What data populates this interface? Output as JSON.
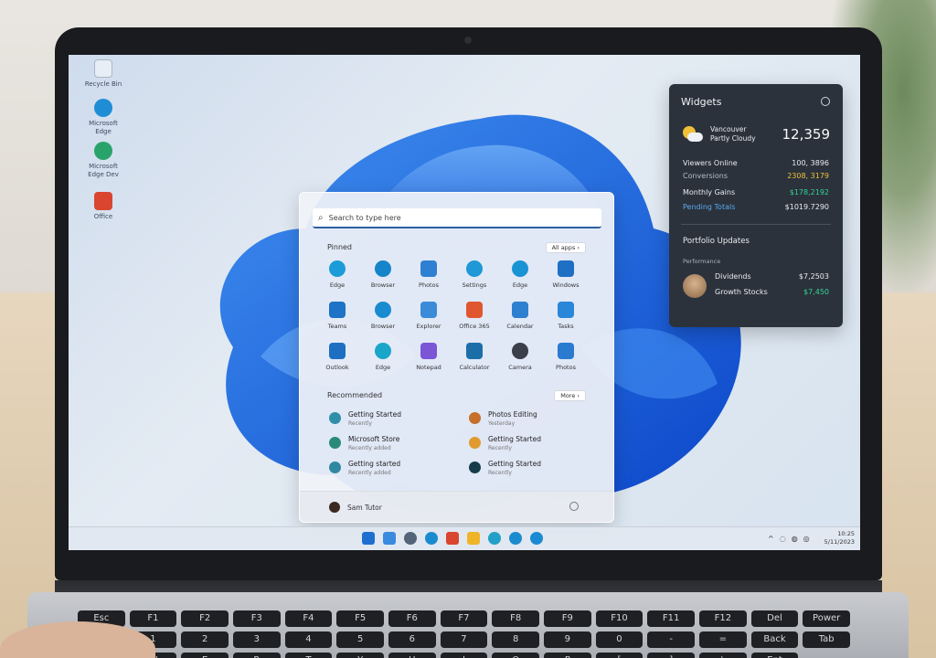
{
  "desktop": {
    "icons": [
      {
        "label": "Recycle Bin",
        "icon": "recycle-bin-icon",
        "color": "#e8eef5"
      },
      {
        "label": "Microsoft Edge",
        "icon": "edge-icon",
        "color": "#1f8dd6"
      },
      {
        "label": "Microsoft Edge Dev",
        "icon": "edge-icon",
        "color": "#2aa36b"
      },
      {
        "label": "Office",
        "icon": "office-icon",
        "color": "#d9452f"
      }
    ]
  },
  "start_menu": {
    "search_placeholder": "Search to type here",
    "pinned": {
      "title": "Pinned",
      "button": "All apps  ›"
    },
    "apps": [
      {
        "label": "Edge",
        "icon": "edge-icon",
        "color": "#1b9bd8"
      },
      {
        "label": "Browser",
        "icon": "edge-icon",
        "color": "#1584c8"
      },
      {
        "label": "Photos",
        "icon": "photos-icon",
        "color": "#2f7fd2"
      },
      {
        "label": "Settings",
        "icon": "edge-icon",
        "color": "#1e98d6"
      },
      {
        "label": "Edge",
        "icon": "edge-icon",
        "color": "#1893d4"
      },
      {
        "label": "Windows",
        "icon": "windows-icon",
        "color": "#1f6fc4"
      },
      {
        "label": "Teams",
        "icon": "teams-icon",
        "color": "#1e73c6"
      },
      {
        "label": "Browser",
        "icon": "edge-icon",
        "color": "#1a8bd0"
      },
      {
        "label": "Explorer",
        "icon": "folder-icon",
        "color": "#3b8bd8"
      },
      {
        "label": "Office 365",
        "icon": "office-icon",
        "color": "#e0562f"
      },
      {
        "label": "Calendar",
        "icon": "calendar-icon",
        "color": "#2d7fd0"
      },
      {
        "label": "Tasks",
        "icon": "tasks-icon",
        "color": "#2a86d8"
      },
      {
        "label": "Outlook",
        "icon": "outlook-icon",
        "color": "#1e6fc1"
      },
      {
        "label": "Edge",
        "icon": "edge-icon",
        "color": "#1aa6c8"
      },
      {
        "label": "Notepad",
        "icon": "notepad-icon",
        "color": "#7a55d6"
      },
      {
        "label": "Calculator",
        "icon": "calculator-icon",
        "color": "#1c6ea8"
      },
      {
        "label": "Camera",
        "icon": "camera-icon",
        "color": "#3a3f4a"
      },
      {
        "label": "Photos",
        "icon": "photos-icon",
        "color": "#2a7ad0"
      }
    ],
    "recommended": {
      "title": "Recommended",
      "button": "More  ›"
    },
    "rec_items": [
      {
        "title": "Getting Started",
        "sub": "Recently",
        "icon": "app-icon",
        "color": "#2f8fa8"
      },
      {
        "title": "Photos Editing",
        "sub": "Yesterday",
        "icon": "folder-icon",
        "color": "#c6702a"
      },
      {
        "title": "Microsoft Store",
        "sub": "Recently added",
        "icon": "store-icon",
        "color": "#2a8a7a"
      },
      {
        "title": "Getting Started",
        "sub": "Recently",
        "icon": "app-icon",
        "color": "#e09a2f"
      },
      {
        "title": "Getting started",
        "sub": "Recently added",
        "icon": "app-icon",
        "color": "#2f88a0"
      },
      {
        "title": "Getting Started",
        "sub": "Recently",
        "icon": "app-icon",
        "color": "#163c4a"
      }
    ],
    "user_name": "Sam Tutor"
  },
  "widgets": {
    "title": "Widgets",
    "weather": {
      "line1": "Vancouver",
      "line2": "Partly Cloudy",
      "value": "12,359"
    },
    "stats": [
      {
        "label": "Viewers Online",
        "value": "100, 3896",
        "color": "#e8ecf1"
      },
      {
        "label": "Conversions",
        "value": "2308, 3179",
        "color": "#f0c038"
      },
      {
        "label": "Monthly Gains",
        "value": "$178,2192",
        "color": "#34d399"
      },
      {
        "label": "Pending Totals",
        "value": "$1019.7290",
        "color": "#5aa9f0"
      }
    ],
    "section": "Portfolio Updates",
    "section_sub": "Performance",
    "people": [
      {
        "name": "Dividends",
        "value": "$7,2503"
      },
      {
        "name": "Growth Stocks",
        "value": "$7,450"
      }
    ]
  },
  "taskbar": {
    "icons": [
      {
        "icon": "start-icon",
        "color": "#1e6fd0"
      },
      {
        "icon": "windows-icon",
        "color": "#3a8ae0"
      },
      {
        "icon": "search-icon",
        "color": "#54657a"
      },
      {
        "icon": "edge-icon",
        "color": "#1b8bd0"
      },
      {
        "icon": "office-icon",
        "color": "#d9452f"
      },
      {
        "icon": "folder-icon",
        "color": "#f0b428"
      },
      {
        "icon": "edge-icon",
        "color": "#22a0c8"
      },
      {
        "icon": "edge-icon",
        "color": "#1b8bd0"
      },
      {
        "icon": "edge-icon",
        "color": "#1a8ad2"
      }
    ],
    "time": "10:25",
    "date": "5/11/2023"
  },
  "keyboard": {
    "keys": [
      "Esc",
      "F1",
      "F2",
      "F3",
      "F4",
      "F5",
      "F6",
      "F7",
      "F8",
      "F9",
      "F10",
      "F11",
      "F12",
      "Del",
      "Power",
      "~",
      "1",
      "2",
      "3",
      "4",
      "5",
      "6",
      "7",
      "8",
      "9",
      "0",
      "-",
      "=",
      "Back",
      "Tab",
      "Q",
      "W",
      "E",
      "R",
      "T",
      "Y",
      "U",
      "I",
      "O",
      "P",
      "[",
      "]",
      "\\",
      "Ent"
    ]
  }
}
